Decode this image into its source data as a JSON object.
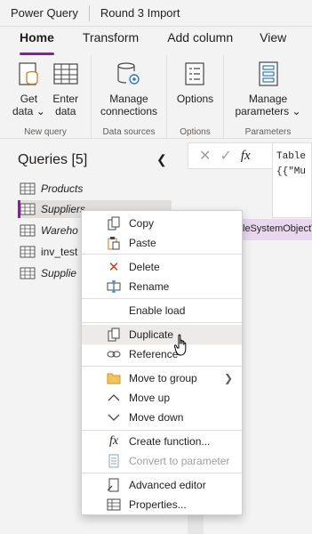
{
  "title_bar": {
    "app": "Power Query",
    "document": "Round 3 Import"
  },
  "tabs": [
    "Home",
    "Transform",
    "Add column",
    "View"
  ],
  "ribbon": {
    "get_data": {
      "line1": "Get",
      "line2": "data ⌄"
    },
    "enter_data": {
      "line1": "Enter",
      "line2": "data"
    },
    "manage_connections": {
      "line1": "Manage",
      "line2": "connections"
    },
    "options": "Options",
    "manage_parameters": {
      "line1": "Manage",
      "line2": "parameters ⌄"
    },
    "groups": [
      "New query",
      "Data sources",
      "Options",
      "Parameters"
    ]
  },
  "queries": {
    "title": "Queries [5]",
    "items": [
      "Products",
      "Suppliers",
      "Wareho",
      "inv_test",
      "Supplie"
    ]
  },
  "formula": {
    "fx": "fx",
    "preview_line1": "Table",
    "preview_line2": "{{\"Mu"
  },
  "column_header": "leSystemObjectT",
  "context_menu": {
    "copy": "Copy",
    "paste": "Paste",
    "delete": "Delete",
    "rename": "Rename",
    "enable_load": "Enable load",
    "duplicate": "Duplicate",
    "reference": "Reference",
    "move_to_group": "Move to group",
    "move_up": "Move up",
    "move_down": "Move down",
    "create_function": "Create function...",
    "convert_to_parameter": "Convert to parameter",
    "advanced_editor": "Advanced editor",
    "properties": "Properties..."
  },
  "colors": {
    "accent": "#7a2a8a",
    "icon_blue": "#2b79c2",
    "delete_red": "#c43e1c",
    "folder": "#f4c25b"
  }
}
